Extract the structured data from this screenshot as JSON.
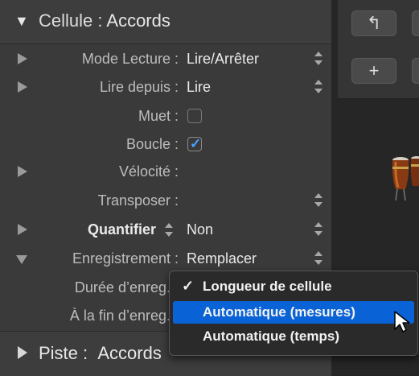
{
  "region": {
    "header_label": "Cellule :",
    "header_value": "Accords"
  },
  "rows": [
    {
      "label": "Mode Lecture :",
      "value": "Lire/Arrêter"
    },
    {
      "label": "Lire depuis :",
      "value": "Lire"
    },
    {
      "label": "Muet :",
      "checked": false
    },
    {
      "label": "Boucle :",
      "checked": true
    },
    {
      "label": "Vélocité :",
      "value": ""
    },
    {
      "label": "Transposer :",
      "value": ""
    },
    {
      "label": "Quantifier",
      "value": "Non"
    },
    {
      "label": "Enregistrement :",
      "value": "Remplacer"
    },
    {
      "label": "Durée d’enreg. :"
    },
    {
      "label": "À la fin d’enreg. :"
    }
  ],
  "track": {
    "label": "Piste :",
    "value": "Accords"
  },
  "toolbar": {
    "back_glyph": "↰",
    "add_glyph": "+"
  },
  "menu": {
    "items": [
      {
        "label": "Longueur de cellule",
        "checked": true,
        "highlighted": false
      },
      {
        "label": "Automatique (mesures)",
        "checked": false,
        "highlighted": true
      },
      {
        "label": "Automatique (temps)",
        "checked": false,
        "highlighted": false
      }
    ],
    "check_glyph": "✓"
  },
  "colors": {
    "accent": "#0a63d6",
    "checkmark": "#4aa2ff"
  }
}
